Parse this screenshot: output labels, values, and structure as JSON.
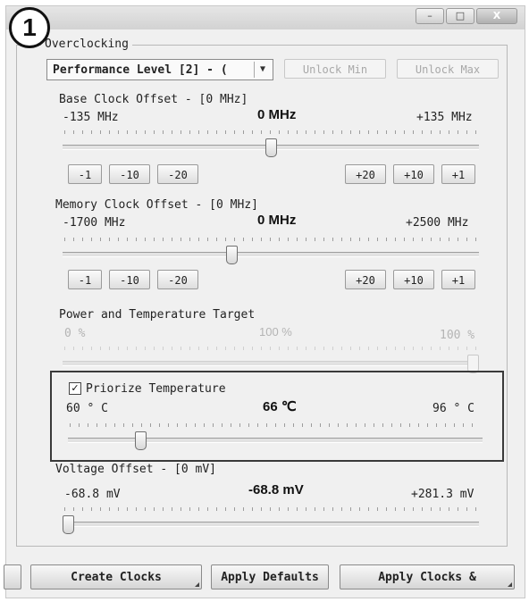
{
  "badge": "1",
  "window": {
    "controls": [
      "–",
      "□",
      "X"
    ]
  },
  "overclocking": {
    "group_label": "Overclocking",
    "performance_level": "Performance Level [2] - (",
    "unlock_min_label": "Unlock Min",
    "unlock_max_label": "Unlock Max"
  },
  "base_clock": {
    "title": "Base Clock Offset - [0 MHz]",
    "min": "-135 MHz",
    "current": "0 MHz",
    "max": "+135 MHz",
    "value": 0,
    "range": [
      -135,
      135
    ],
    "steps_down": [
      "-1",
      "-10",
      "-20"
    ],
    "steps_up": [
      "+20",
      "+10",
      "+1"
    ]
  },
  "memory_clock": {
    "title": "Memory Clock Offset - [0 MHz]",
    "min": "-1700 MHz",
    "current": "0 MHz",
    "max": "+2500 MHz",
    "value": 0,
    "range": [
      -1700,
      2500
    ],
    "steps_down": [
      "-1",
      "-10",
      "-20"
    ],
    "steps_up": [
      "+20",
      "+10",
      "+1"
    ]
  },
  "power_target": {
    "title": "Power and Temperature Target",
    "min": "0 %",
    "current": "100 %",
    "max": "100 %",
    "value": 100,
    "range": [
      0,
      100
    ]
  },
  "temperature": {
    "checkbox_label": "Priorize Temperature",
    "checked": true,
    "min": "60 ° C",
    "current": "66 ℃",
    "max": "96 ° C",
    "value": 66,
    "range": [
      60,
      96
    ]
  },
  "voltage": {
    "title": "Voltage Offset - [0 mV]",
    "min": "-68.8 mV",
    "current": "-68.8 mV",
    "max": "+281.3 mV",
    "value": -68.8,
    "range": [
      -68.8,
      281.3
    ]
  },
  "bottom": {
    "create_clocks": "Create Clocks",
    "apply_defaults": "Apply Defaults",
    "apply_clocks": "Apply Clocks &"
  },
  "colors": {
    "window_bg": "#f0f0f0",
    "highlight_border": "#3a3a3a"
  }
}
